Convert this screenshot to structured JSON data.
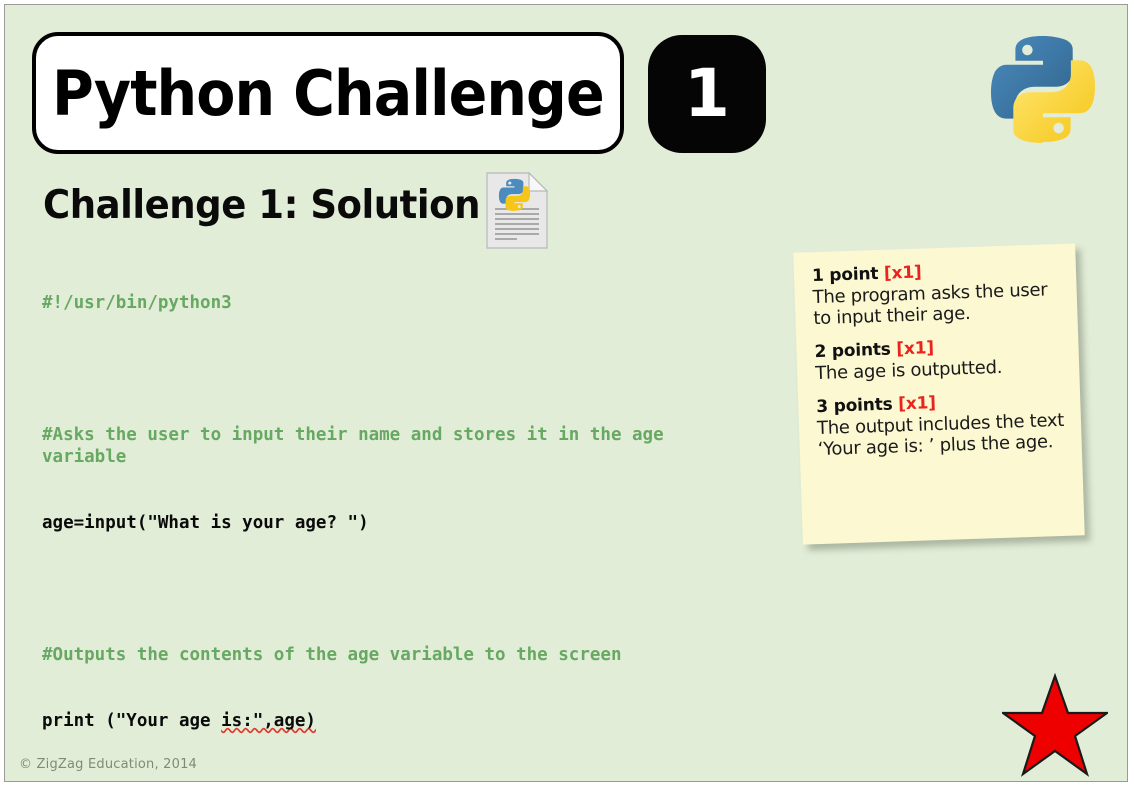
{
  "slide": {
    "background_color": "#e2edd8",
    "title": "Python Challenge",
    "challenge_number": "1",
    "section_heading": "Challenge 1: Solution",
    "footer": "© ZigZag Education, 2014"
  },
  "icons": {
    "python_logo": "python-logo-icon",
    "document": "python-document-icon",
    "star": "red-star-icon"
  },
  "colors": {
    "background": "#e2edd8",
    "comment_green": "#67a862",
    "code_black": "#0a0a0a",
    "note_yellow": "#fbf8d2",
    "accent_red": "#e8241c",
    "star_red": "#ef0000",
    "python_blue": "#3c77a8",
    "python_yellow": "#ffd342"
  },
  "code": {
    "lines": [
      {
        "type": "comment",
        "text": "#!/usr/bin/python3"
      },
      {
        "type": "blank",
        "text": ""
      },
      {
        "type": "comment",
        "text": "#Asks the user to input their name and stores it in the age variable"
      },
      {
        "type": "code",
        "text": "age=input(\"What is your age? \")"
      },
      {
        "type": "blank",
        "text": ""
      },
      {
        "type": "comment",
        "text": "#Outputs the contents of the age variable to the screen"
      },
      {
        "type": "code",
        "text": "print (\"Your age ",
        "spellcheck": "is:\",age)"
      }
    ]
  },
  "sticky_note": {
    "items": [
      {
        "heading": "1 point ",
        "multiplier": "[x1]",
        "body": "The program asks the user to input their age."
      },
      {
        "heading": "2 points ",
        "multiplier": "[x1]",
        "body": "The age is outputted."
      },
      {
        "heading": "3 points ",
        "multiplier": "[x1]",
        "body": "The output includes the text ‘Your age is: ’ plus the age."
      }
    ]
  }
}
